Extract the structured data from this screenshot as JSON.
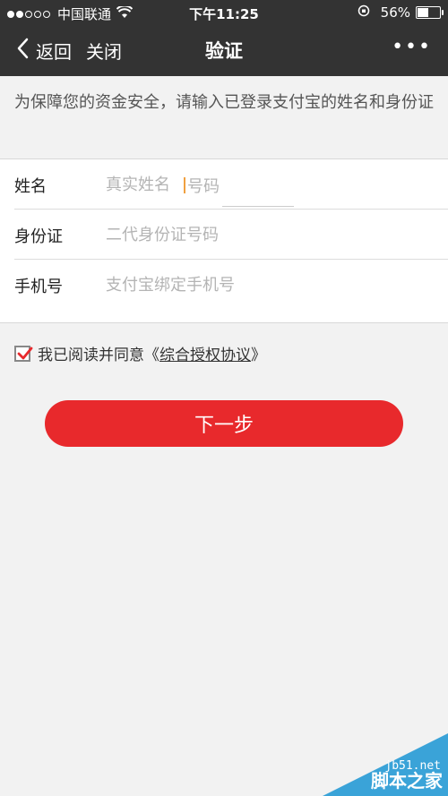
{
  "status_bar": {
    "carrier": "中国联通",
    "time": "下午11:25",
    "battery_percent": "56%",
    "battery_level": 0.56,
    "signal_filled": 2,
    "signal_total": 5
  },
  "nav": {
    "back_label": "返回",
    "close_label": "关闭",
    "title": "验证",
    "more_label": "•••"
  },
  "notice": "为保障您的资金安全，请输入已登录支付宝的姓名和身份证",
  "form": {
    "name": {
      "label": "姓名",
      "placeholder": "真实姓名",
      "ghost_text": "号码"
    },
    "id_card": {
      "label": "身份证",
      "placeholder": "二代身份证号码"
    },
    "phone": {
      "label": "手机号",
      "placeholder": "支付宝绑定手机号"
    }
  },
  "agreement": {
    "checked": true,
    "prefix": "我已阅读并同意《",
    "link": "综合授权协议",
    "suffix": "》"
  },
  "next_button": "下一步",
  "watermark": {
    "url": "jb51.net",
    "name": "脚本之家"
  },
  "colors": {
    "bar": "#333333",
    "accent": "#e8292c",
    "background": "#f2f2f2"
  }
}
